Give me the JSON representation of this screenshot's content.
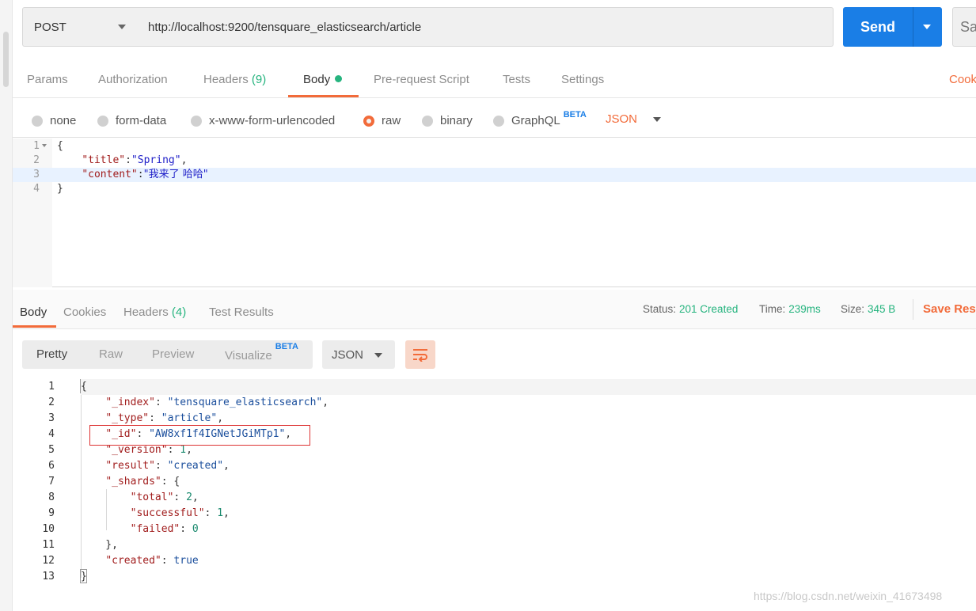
{
  "request": {
    "method": "POST",
    "url": "http://localhost:9200/tensquare_elasticsearch/article",
    "send_label": "Send",
    "save_label": "Sa"
  },
  "request_tabs": [
    {
      "label": "Params"
    },
    {
      "label": "Authorization"
    },
    {
      "label": "Headers",
      "count": "(9)"
    },
    {
      "label": "Body"
    },
    {
      "label": "Pre-request Script"
    },
    {
      "label": "Tests"
    },
    {
      "label": "Settings"
    }
  ],
  "cookies_label": "Cook",
  "body_options": {
    "none": "none",
    "form_data": "form-data",
    "urlencoded": "x-www-form-urlencoded",
    "raw": "raw",
    "binary": "binary",
    "graphql": "GraphQL",
    "beta": "BETA",
    "format": "JSON"
  },
  "request_body": {
    "line_numbers": [
      "1",
      "2",
      "3",
      "4"
    ],
    "open_brace": "{",
    "title_key": "\"title\"",
    "title_value": "\"Spring\"",
    "content_key": "\"content\"",
    "content_value": "\"我来了 哈哈\"",
    "close_brace": "}"
  },
  "response_tabs": [
    {
      "label": "Body"
    },
    {
      "label": "Cookies"
    },
    {
      "label": "Headers",
      "count": "(4)"
    },
    {
      "label": "Test Results"
    }
  ],
  "response_meta": {
    "status_label": "Status:",
    "status_value": "201 Created",
    "time_label": "Time:",
    "time_value": "239ms",
    "size_label": "Size:",
    "size_value": "345 B",
    "save_response": "Save Resp"
  },
  "view_modes": {
    "pretty": "Pretty",
    "raw": "Raw",
    "preview": "Preview",
    "visualize": "Visualize",
    "beta": "BETA",
    "format": "JSON"
  },
  "response_body": {
    "line_numbers": [
      "1",
      "2",
      "3",
      "4",
      "5",
      "6",
      "7",
      "8",
      "9",
      "10",
      "11",
      "12",
      "13"
    ],
    "index_key": "\"_index\"",
    "index_value": "\"tensquare_elasticsearch\"",
    "type_key": "\"_type\"",
    "type_value": "\"article\"",
    "id_key": "\"_id\"",
    "id_value": "\"AW8xf1f4IGNetJGiMTp1\"",
    "version_key": "\"_version\"",
    "version_value": "1",
    "result_key": "\"result\"",
    "result_value": "\"created\"",
    "shards_key": "\"_shards\"",
    "total_key": "\"total\"",
    "total_value": "2",
    "successful_key": "\"successful\"",
    "successful_value": "1",
    "failed_key": "\"failed\"",
    "failed_value": "0",
    "created_key": "\"created\"",
    "created_value": "true"
  },
  "watermark": "https://blog.csdn.net/weixin_41673498",
  "colors": {
    "accent": "#f26b3a",
    "send": "#1a7ee6",
    "success": "#26b47f"
  }
}
